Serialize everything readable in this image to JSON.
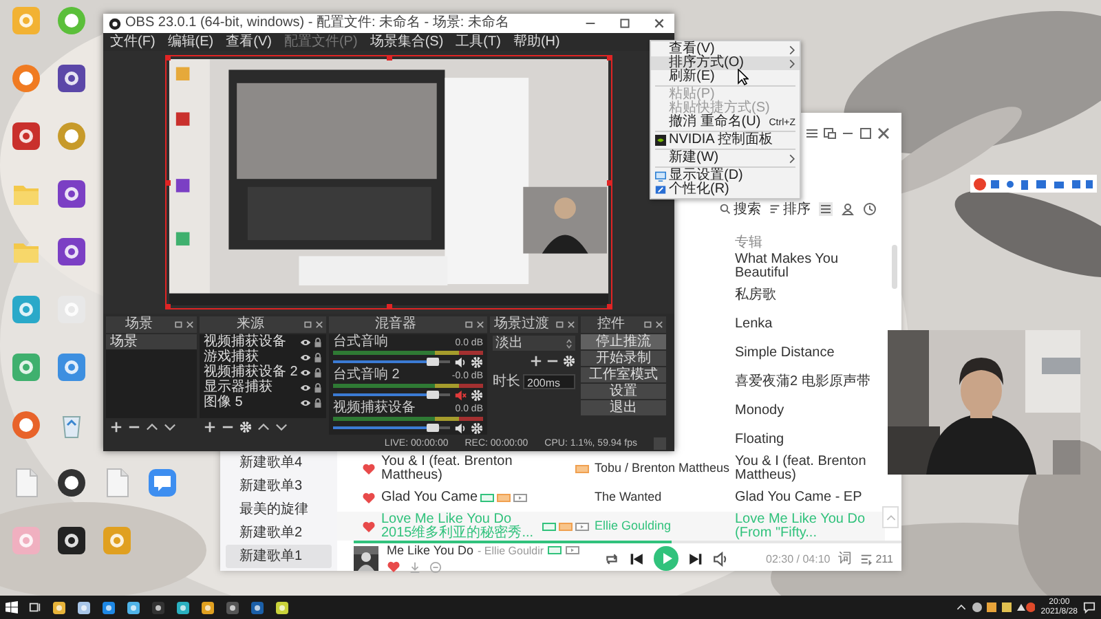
{
  "obs": {
    "title": "OBS 23.0.1 (64-bit, windows) - 配置文件: 未命名 - 场景: 未命名",
    "menu": [
      {
        "label": "文件(F)",
        "disabled": false
      },
      {
        "label": "编辑(E)",
        "disabled": false
      },
      {
        "label": "查看(V)",
        "disabled": false
      },
      {
        "label": "配置文件(P)",
        "disabled": true
      },
      {
        "label": "场景集合(S)",
        "disabled": false
      },
      {
        "label": "工具(T)",
        "disabled": false
      },
      {
        "label": "帮助(H)",
        "disabled": false
      }
    ],
    "scenes": {
      "title": "场景",
      "items": [
        {
          "name": "场景",
          "selected": true
        }
      ]
    },
    "sources": {
      "title": "来源",
      "items": [
        {
          "name": "视频捕获设备",
          "visible": true,
          "selected": false
        },
        {
          "name": "游戏捕获",
          "visible": true,
          "selected": false
        },
        {
          "name": "视频捕获设备 2",
          "visible": true,
          "selected": false
        },
        {
          "name": "显示器捕获",
          "visible": true,
          "selected": false
        },
        {
          "name": "图像 5",
          "visible": true,
          "selected": false
        }
      ]
    },
    "mixer": {
      "title": "混音器",
      "channels": [
        {
          "name": "台式音响",
          "reading": "0.0 dB",
          "level": 0.9,
          "muted": false
        },
        {
          "name": "台式音响 2",
          "reading": "-0.0 dB",
          "level": 0.9,
          "muted": true
        },
        {
          "name": "视频捕获设备",
          "reading": "0.0 dB",
          "level": 0.9,
          "muted": false
        }
      ]
    },
    "transitions": {
      "title": "场景过渡",
      "transition": "淡出",
      "duration_label": "时长",
      "duration": "200ms"
    },
    "controls": {
      "title": "控件",
      "buttons": [
        {
          "label": "停止推流",
          "active": true
        },
        {
          "label": "开始录制",
          "active": false
        },
        {
          "label": "工作室模式",
          "active": false
        },
        {
          "label": "设置",
          "active": false
        },
        {
          "label": "退出",
          "active": false
        }
      ]
    },
    "status_bar": {
      "live": "LIVE: 00:00:00",
      "rec": "REC: 00:00:00",
      "cpu": "CPU: 1.1%, 59.94 fps"
    }
  },
  "context_menu": {
    "items": [
      {
        "kind": "item",
        "label": "查看(V)",
        "submenu": true,
        "disabled": false,
        "selected": false
      },
      {
        "kind": "item",
        "label": "排序方式(O)",
        "submenu": true,
        "disabled": false,
        "selected": true
      },
      {
        "kind": "item",
        "label": "刷新(E)",
        "submenu": false,
        "disabled": false,
        "selected": false
      },
      {
        "kind": "separator"
      },
      {
        "kind": "item",
        "label": "粘贴(P)",
        "submenu": false,
        "disabled": true,
        "selected": false
      },
      {
        "kind": "item",
        "label": "粘贴快捷方式(S)",
        "submenu": false,
        "disabled": true,
        "selected": false
      },
      {
        "kind": "item",
        "label": "撤消 重命名(U)",
        "shortcut": "Ctrl+Z",
        "submenu": false,
        "disabled": false,
        "selected": false
      },
      {
        "kind": "separator"
      },
      {
        "kind": "nvidia",
        "label": "NVIDIA 控制面板",
        "submenu": false,
        "disabled": false,
        "selected": false
      },
      {
        "kind": "separator"
      },
      {
        "kind": "item",
        "label": "新建(W)",
        "submenu": true,
        "disabled": false,
        "selected": false
      },
      {
        "kind": "separator"
      },
      {
        "kind": "display",
        "label": "显示设置(D)",
        "submenu": false,
        "disabled": false,
        "selected": false
      },
      {
        "kind": "personalize",
        "label": "个性化(R)",
        "submenu": false,
        "disabled": false,
        "selected": false
      }
    ]
  },
  "music_player": {
    "playlists": [
      {
        "name": "新建歌单4",
        "selected": false
      },
      {
        "name": "新建歌单3",
        "selected": false
      },
      {
        "name": "最美的旋律",
        "selected": false
      },
      {
        "name": "新建歌单2",
        "selected": false
      },
      {
        "name": "新建歌单1",
        "selected": true
      }
    ],
    "toolbar": {
      "search": "搜索",
      "sort": "排序"
    },
    "album_header": "专辑",
    "tracks": [
      {
        "album": "What Makes You Beautiful",
        "selected": false
      },
      {
        "album": "私房歌",
        "selected": false
      },
      {
        "album": "Lenka",
        "selected": false
      },
      {
        "album": "Simple Distance",
        "selected": false
      },
      {
        "album": "喜爱夜蒲2 电影原声带",
        "selected": false
      },
      {
        "album": "Monody",
        "selected": false
      },
      {
        "album": "Floating",
        "selected": false
      },
      {
        "liked": true,
        "title": "You & I (feat. Brenton Mattheus)",
        "tags": [
          {
            "kind": "vip"
          }
        ],
        "artist": "Tobu / Brenton Mattheus",
        "album": "You & I (feat. Brenton Mattheus)",
        "selected": false
      },
      {
        "liked": true,
        "title": "Glad You Came",
        "tags": [
          {
            "kind": "quality"
          },
          {
            "kind": "vip"
          },
          {
            "kind": "mv"
          }
        ],
        "artist": "The Wanted",
        "album": "Glad You Came - EP",
        "selected": false
      },
      {
        "liked": true,
        "title": "Love Me Like You Do 2015维多利亚的秘密秀...",
        "tags": [
          {
            "kind": "quality"
          },
          {
            "kind": "vip"
          },
          {
            "kind": "mv"
          }
        ],
        "artist": "Ellie Goulding",
        "album": "Love Me Like You Do (From \"Fifty...",
        "selected": true
      }
    ],
    "now_playing": {
      "title": "Me Like You Do",
      "artist": "- Ellie Gouldir",
      "tags": [
        {
          "kind": "quality"
        },
        {
          "kind": "mv"
        }
      ],
      "liked": true,
      "playing": false,
      "level": 0.58,
      "time": "02:30 / 04:10",
      "lyrics": "词",
      "queue_count": "211"
    }
  },
  "taskbar": {
    "time": "20:00",
    "date": "2021/8/28"
  }
}
